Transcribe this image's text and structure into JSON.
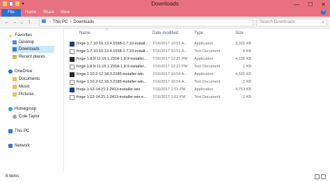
{
  "window": {
    "title": "Downloads",
    "controls": [
      "—",
      "☐",
      "✕"
    ]
  },
  "ribbon": {
    "file_label": "File",
    "tabs": [
      "Home",
      "Share",
      "View"
    ],
    "help": "?"
  },
  "address": {
    "crumbs": [
      "This PC",
      "Downloads"
    ],
    "search_placeholder": "Search Downloads"
  },
  "nav": {
    "favorites": "Favorites",
    "desktop": "Desktop",
    "downloads": "Downloads",
    "recent": "Recent places",
    "onedrive": "OneDrive",
    "documents": "Documents",
    "music": "Music",
    "pictures": "Pictures",
    "homegroup": "Homegroup",
    "user": "Cole Taylor",
    "thispc": "This PC",
    "network": "Network"
  },
  "columns": {
    "name": "Name",
    "date": "Date modified",
    "type": "Type",
    "size": "Size"
  },
  "files": [
    {
      "name": "forge-1.7.10-10.13.4.1558-1.7.10-install...",
      "date": "7/16/2017 10:51 A...",
      "type": "Application",
      "size": "3,325 KB",
      "icon": "app-blue"
    },
    {
      "name": "forge-1.7.10-10.13.4.1558-1.7.10-install...",
      "date": "7/16/2017 10:51 A...",
      "type": "Text Document",
      "size": "0 KB",
      "icon": "doc"
    },
    {
      "name": "forge-1.8.9-11.15.1.2318-1.8.9-installer...",
      "date": "7/16/2017 12:21 PM",
      "type": "Application",
      "size": "4,136 KB",
      "icon": "app-dark"
    },
    {
      "name": "forge-1.8.9-11.15.1.2318-1.8.9-installer...",
      "date": "7/16/2017 12:21 PM",
      "type": "Text Document",
      "size": "1 KB",
      "icon": "doc"
    },
    {
      "name": "forge-1.10.2-12.18.3.2185-installer-win",
      "date": "7/16/2017 10:54 A...",
      "type": "Application",
      "size": "4,505 KB",
      "icon": "app-dark"
    },
    {
      "name": "forge-1.10.2-12.18.3.2185-installer-win...",
      "date": "7/16/2017 10:54 A...",
      "type": "Text Document",
      "size": "2 KB",
      "icon": "doc"
    },
    {
      "name": "forge-1.12-14.21.1.2413-installer-win",
      "date": "7/16/2017 1:01 PM",
      "type": "Application",
      "size": "4,753 KB",
      "icon": "app-blue"
    },
    {
      "name": "forge-1.12-14.21.1.2413-installer-win.e...",
      "date": "7/16/2017 1:02 PM",
      "type": "Text Document",
      "size": "2 KB",
      "icon": "doc"
    }
  ],
  "status": {
    "count": "8 items"
  }
}
